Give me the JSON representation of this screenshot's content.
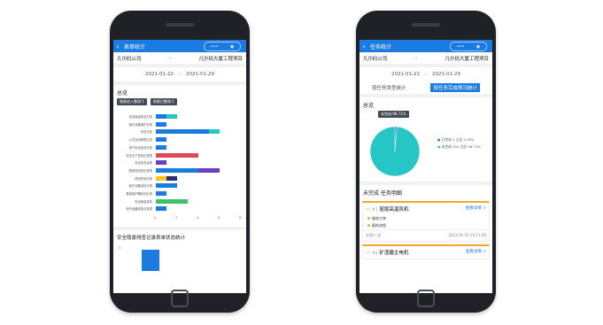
{
  "left": {
    "title": "表单统计",
    "company": "凡尔码公司",
    "dash": "-",
    "project": "凡尔码大厦工程项目",
    "date_from": "2021-01-22",
    "date_to": "2021-01-29",
    "overview_title": "总览",
    "legend_pending": "隐患进入整改:1",
    "legend_done": "隐患已整改:1",
    "bar_categories": [
      "安全隐患检查记录",
      "医疗设备维护记录",
      "安全日检",
      "火灾自动报警主机",
      "电气安全检查记录",
      "安全生产检查记录表",
      "安全检查台账",
      "配电室巡检记录表",
      "值班签到记录",
      "医疗设备巡检记录",
      "漏电保护器检测记录",
      "安全隐患排查",
      "电气设备巡检记录表"
    ],
    "xticks": [
      "0",
      "2",
      "4",
      "6",
      "8"
    ],
    "status_title": "安全隐患排查记录表单状态统计",
    "status_ytick": "3"
  },
  "right": {
    "title": "任务统计",
    "company": "凡尔码公司",
    "dash": "-",
    "project": "凡尔码大厦工程项目",
    "date_from": "2021-01-22",
    "date_to": "2021-01-29",
    "tab_type": "按任务类型统计",
    "tab_done": "按任务完成情况统计",
    "overview_title": "总览",
    "tooltip": "未完成:98.71%",
    "legend_done": "已完成  4 占比 1.29%",
    "legend_undone": "未完成  305 占比 98.71%",
    "undone_title": "未完成 任务明细",
    "cards": [
      {
        "num": "#1",
        "name": "窑尾高温风机",
        "link": "查看详情 >",
        "items": [
          "维修工单",
          "报修流程"
        ],
        "person_label": "办理人:",
        "person": "无",
        "time": "2021-01-29 10:11:06"
      },
      {
        "num": "#2",
        "name": "矿渣磨主电机",
        "link": "查看详情 >"
      }
    ]
  },
  "colors": {
    "accent": "#1c7be0",
    "teal": "#26c6c6",
    "red": "#e0485a",
    "purple": "#6a3fbf",
    "green": "#3cc46a",
    "yellow": "#f5c518",
    "navy": "#2a2f6e",
    "orange": "#f4a72c"
  },
  "chart_data": [
    {
      "type": "bar",
      "orientation": "horizontal",
      "title": "总览",
      "categories": [
        "安全隐患检查记录",
        "医疗设备维护记录",
        "安全日检",
        "火灾自动报警主机",
        "电气安全检查记录",
        "安全生产检查记录表",
        "安全检查台账",
        "配电室巡检记录表",
        "值班签到记录",
        "医疗设备巡检记录",
        "漏电保护器检测记录",
        "安全隐患排查",
        "电气设备巡检记录表"
      ],
      "series": [
        {
          "name": "隐患进入整改",
          "values": [
            1,
            1,
            5,
            1,
            1,
            0,
            1,
            4,
            1,
            2,
            1,
            2,
            1
          ]
        },
        {
          "name": "隐患已整改",
          "values": [
            1,
            0,
            1,
            0,
            0,
            4,
            0,
            2,
            1,
            0,
            0,
            1,
            0
          ]
        }
      ],
      "xlim": [
        0,
        8
      ]
    },
    {
      "type": "pie",
      "title": "总览",
      "labels": [
        "已完成",
        "未完成"
      ],
      "values": [
        4,
        305
      ],
      "percents": [
        1.29,
        98.71
      ]
    }
  ]
}
